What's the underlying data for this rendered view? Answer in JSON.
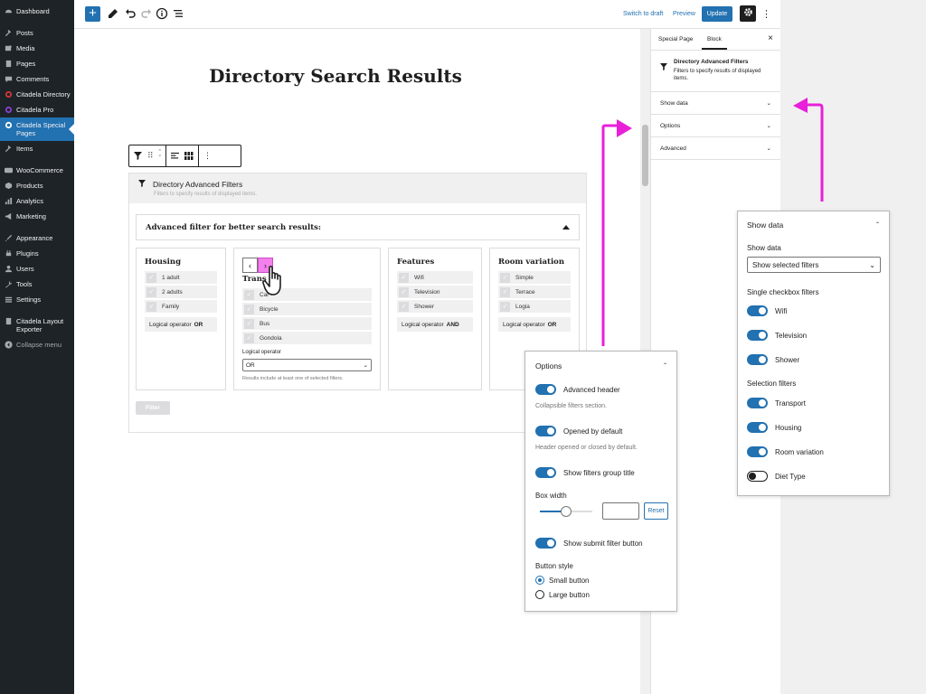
{
  "sidebar": {
    "items": [
      {
        "label": "Dashboard",
        "icon": "dashboard-icon"
      },
      {
        "label": "Posts",
        "icon": "pin-icon"
      },
      {
        "label": "Media",
        "icon": "media-icon"
      },
      {
        "label": "Pages",
        "icon": "pages-icon"
      },
      {
        "label": "Comments",
        "icon": "comment-icon"
      },
      {
        "label": "Citadela Directory",
        "icon": "citadela-icon"
      },
      {
        "label": "Citadela Pro",
        "icon": "citadela-icon"
      },
      {
        "label": "Citadela Special Pages",
        "icon": "citadela-icon"
      },
      {
        "label": "Items",
        "icon": "pin-icon"
      },
      {
        "label": "WooCommerce",
        "icon": "woo-icon"
      },
      {
        "label": "Products",
        "icon": "products-icon"
      },
      {
        "label": "Analytics",
        "icon": "analytics-icon"
      },
      {
        "label": "Marketing",
        "icon": "megaphone-icon"
      },
      {
        "label": "Appearance",
        "icon": "brush-icon"
      },
      {
        "label": "Plugins",
        "icon": "plugin-icon"
      },
      {
        "label": "Users",
        "icon": "users-icon"
      },
      {
        "label": "Tools",
        "icon": "wrench-icon"
      },
      {
        "label": "Settings",
        "icon": "settings-icon"
      },
      {
        "label": "Citadela Layout Exporter",
        "icon": "citadela-icon"
      },
      {
        "label": "Collapse menu",
        "icon": "collapse-icon"
      }
    ]
  },
  "toolbar": {
    "add": "+",
    "switch_to_draft": "Switch to draft",
    "preview": "Preview",
    "update": "Update"
  },
  "editor": {
    "page_title": "Directory Search Results",
    "block": {
      "name": "Directory Advanced Filters",
      "description": "Filters to specify results of displayed items.",
      "header": "Advanced filter for better search results:",
      "groups": {
        "housing": {
          "title": "Housing",
          "items": [
            "1 adult",
            "2 adults",
            "Family"
          ],
          "logic_label": "Logical operator",
          "logic_value": "OR"
        },
        "transport": {
          "title": "Trans",
          "items": [
            "Car",
            "Bicycle",
            "Bus",
            "Gondola"
          ],
          "operator_label": "Logical operator",
          "select_value": "OR",
          "help": "Results include at least one of selected filters."
        },
        "features": {
          "title": "Features",
          "items": [
            "Wifi",
            "Television",
            "Shower"
          ],
          "logic_label": "Logical operator",
          "logic_value": "AND"
        },
        "room": {
          "title": "Room variation",
          "items": [
            "Simple",
            "Terrace",
            "Logia"
          ],
          "logic_label": "Logical operator",
          "logic_value": "OR"
        }
      },
      "filter_button": "Filter"
    }
  },
  "settings": {
    "tabs": [
      "Special Page",
      "Block"
    ],
    "close": "×",
    "block_name": "Directory Advanced Filters",
    "block_desc": "Filters to specify results of displayed items.",
    "panels": [
      "Show data",
      "Options",
      "Advanced"
    ]
  },
  "options_panel": {
    "title": "Options",
    "advanced_header": "Advanced header",
    "advanced_header_help": "Collapsible filters section.",
    "opened_default": "Opened by default",
    "opened_default_help": "Header opened or closed by default.",
    "show_group_title": "Show filters group title",
    "box_width": "Box width",
    "reset": "Reset",
    "slider_value": 0.5,
    "show_submit": "Show submit filter button",
    "button_style": "Button style",
    "small_button": "Small button",
    "large_button": "Large button"
  },
  "showdata_panel": {
    "title": "Show data",
    "show_data_label": "Show data",
    "select_value": "Show selected filters",
    "single_label": "Single checkbox filters",
    "single": [
      {
        "label": "Wifi",
        "on": true
      },
      {
        "label": "Television",
        "on": true
      },
      {
        "label": "Shower",
        "on": true
      }
    ],
    "selection_label": "Selection filters",
    "selection": [
      {
        "label": "Transport",
        "on": true
      },
      {
        "label": "Housing",
        "on": true
      },
      {
        "label": "Room variation",
        "on": true
      },
      {
        "label": "Diet Type",
        "on": false
      }
    ]
  },
  "colors": {
    "accent": "#2271b1",
    "annotation": "#e91fd9",
    "sidebar_bg": "#1d2327"
  }
}
